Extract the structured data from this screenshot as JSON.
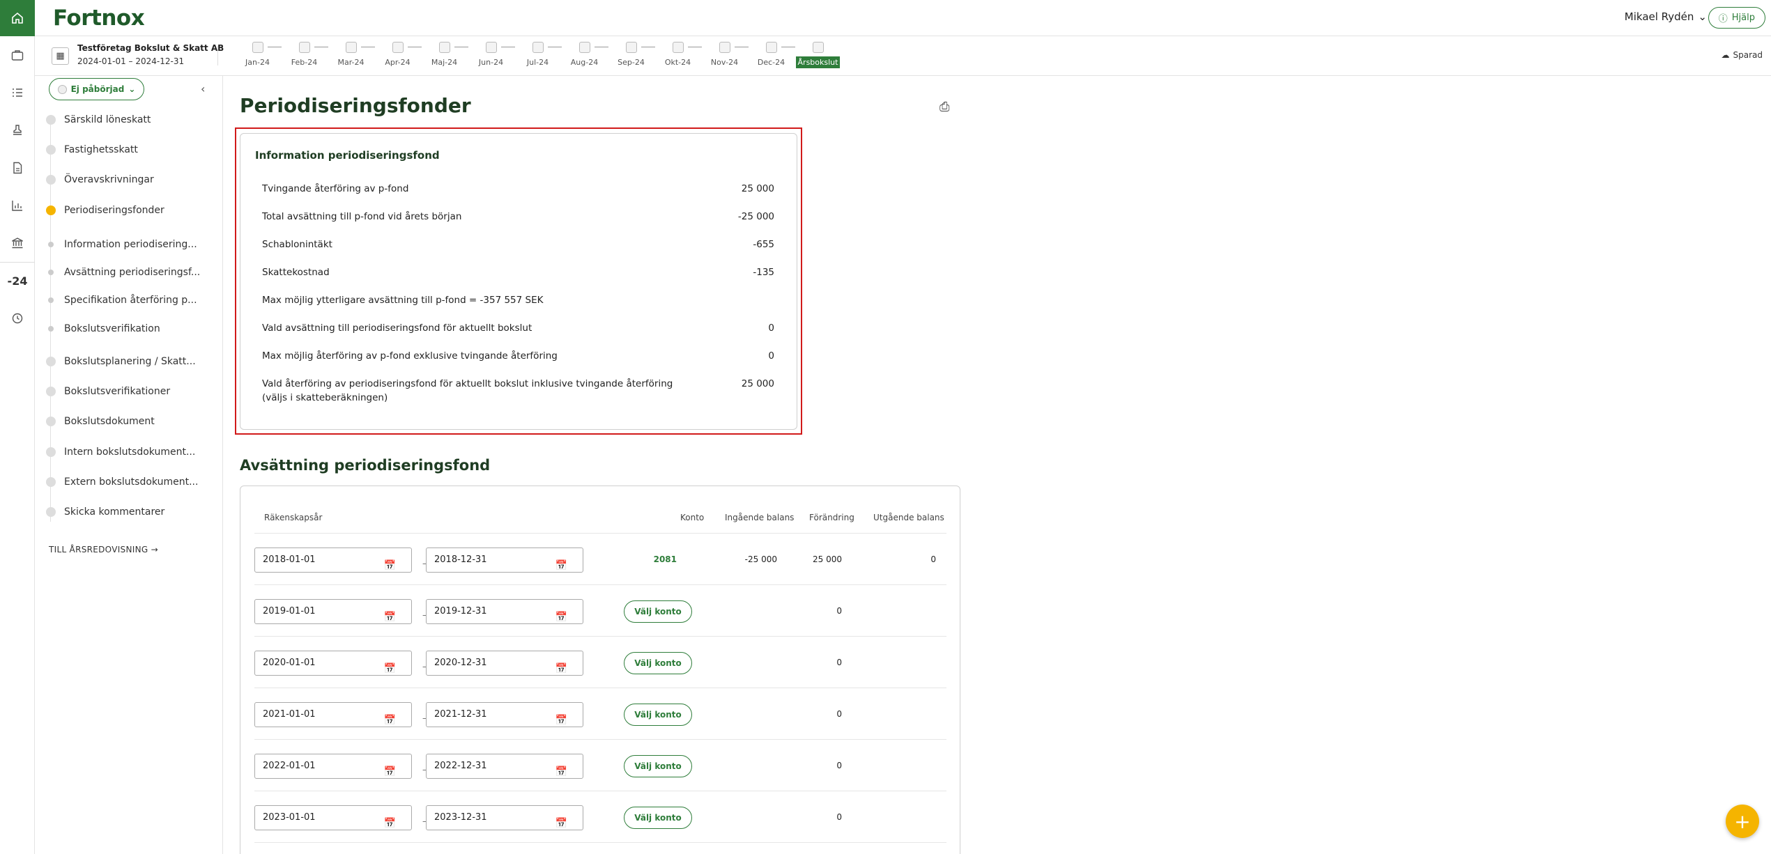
{
  "app": {
    "logo": "Fortnox",
    "user_name": "Mikael Rydén",
    "help_label": "Hjälp",
    "saved_label": "Sparad"
  },
  "rail": {
    "period_short": "-24"
  },
  "company": {
    "name": "Testföretag Bokslut & Skatt AB",
    "dates": "2024-01-01 – 2024-12-31"
  },
  "months": [
    "Jan-24",
    "Feb-24",
    "Mar-24",
    "Apr-24",
    "Maj-24",
    "Jun-24",
    "Jul-24",
    "Aug-24",
    "Sep-24",
    "Okt-24",
    "Nov-24",
    "Dec-24",
    "Årsbokslut"
  ],
  "sidebar": {
    "status": "Ej påbörjad",
    "items": [
      "Särskild löneskatt",
      "Fastighetsskatt",
      "Överavskrivningar",
      "Periodiseringsfonder",
      "Information periodisering...",
      "Avsättning periodiseringsf...",
      "Specifikation återföring p...",
      "Bokslutsverifikation",
      "Bokslutsplanering / Skatt...",
      "Bokslutsverifikationer",
      "Bokslutsdokument",
      "Intern bokslutsdokument...",
      "Extern bokslutsdokument...",
      "Skicka kommentarer"
    ],
    "to_report": "TILL ÅRSREDOVISNING"
  },
  "page": {
    "title": "Periodiseringsfonder"
  },
  "info": {
    "title": "Information periodiseringsfond",
    "rows": [
      {
        "label": "Tvingande återföring av p-fond",
        "value": "25 000"
      },
      {
        "label": "Total avsättning till p-fond vid årets början",
        "value": "-25 000"
      },
      {
        "label": "Schablonintäkt",
        "value": "-655"
      },
      {
        "label": "Skattekostnad",
        "value": "-135"
      },
      {
        "label": "Max möjlig ytterligare avsättning till p-fond = -357 557 SEK",
        "value": ""
      },
      {
        "label": "Vald avsättning till periodiseringsfond för aktuellt bokslut",
        "value": "0"
      },
      {
        "label": "Max möjlig återföring av p-fond exklusive tvingande återföring",
        "value": "0"
      },
      {
        "label": "Vald återföring av periodiseringsfond för aktuellt bokslut inklusive tvingande återföring (väljs i skatteberäkningen)",
        "value": "25 000"
      }
    ]
  },
  "allocation": {
    "title": "Avsättning periodiseringsfond",
    "headers": {
      "year": "Räkenskapsår",
      "account": "Konto",
      "opening": "Ingående balans",
      "change": "Förändring",
      "closing": "Utgående balans"
    },
    "choose_label": "Välj konto",
    "rows": [
      {
        "from": "2018-01-01",
        "to": "2018-12-31",
        "account": "2081",
        "opening": "-25 000",
        "change": "25 000",
        "closing": "0"
      },
      {
        "from": "2019-01-01",
        "to": "2019-12-31",
        "account": "",
        "opening": "",
        "change": "0",
        "closing": ""
      },
      {
        "from": "2020-01-01",
        "to": "2020-12-31",
        "account": "",
        "opening": "",
        "change": "0",
        "closing": ""
      },
      {
        "from": "2021-01-01",
        "to": "2021-12-31",
        "account": "",
        "opening": "",
        "change": "0",
        "closing": ""
      },
      {
        "from": "2022-01-01",
        "to": "2022-12-31",
        "account": "",
        "opening": "",
        "change": "0",
        "closing": ""
      },
      {
        "from": "2023-01-01",
        "to": "2023-12-31",
        "account": "",
        "opening": "",
        "change": "0",
        "closing": ""
      }
    ]
  }
}
